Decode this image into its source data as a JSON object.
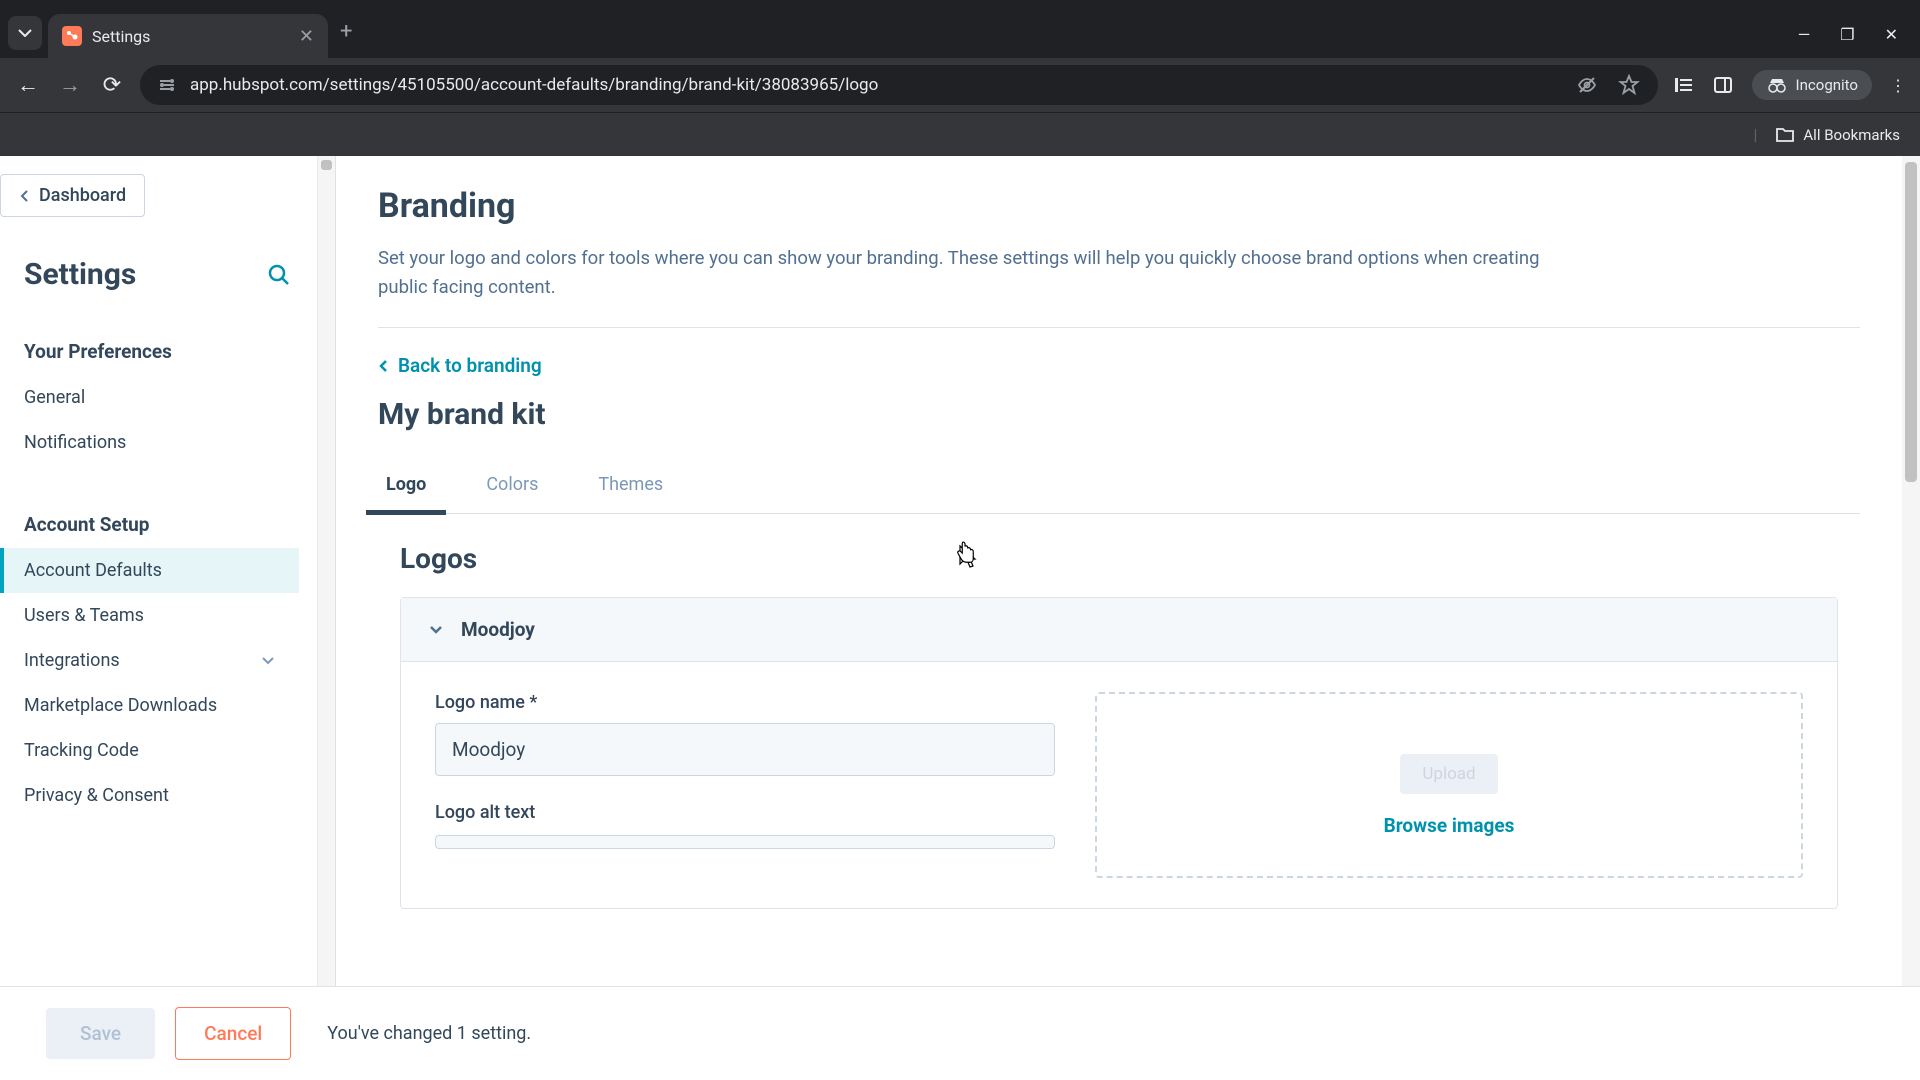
{
  "browser": {
    "tab_title": "Settings",
    "url": "app.hubspot.com/settings/45105500/account-defaults/branding/brand-kit/38083965/logo",
    "incognito_label": "Incognito",
    "bookmarks_label": "All Bookmarks"
  },
  "sidebar": {
    "dashboard_label": "Dashboard",
    "title": "Settings",
    "sections": [
      {
        "header": "Your Preferences",
        "items": [
          "General",
          "Notifications"
        ]
      },
      {
        "header": "Account Setup",
        "items": [
          "Account Defaults",
          "Users & Teams",
          "Integrations",
          "Marketplace Downloads",
          "Tracking Code",
          "Privacy & Consent"
        ]
      }
    ]
  },
  "main": {
    "heading": "Branding",
    "description": "Set your logo and colors for tools where you can show your branding. These settings will help you quickly choose brand options when creating public facing content.",
    "back_link": "Back to branding",
    "subheading": "My brand kit",
    "tabs": [
      "Logo",
      "Colors",
      "Themes"
    ],
    "active_tab": "Logo",
    "section_title": "Logos",
    "accordion_title": "Moodjoy",
    "form": {
      "logo_name_label": "Logo name *",
      "logo_name_value": "Moodjoy",
      "logo_alt_label": "Logo alt text"
    },
    "upload": {
      "button_label": "Upload",
      "browse_label": "Browse images"
    }
  },
  "save_bar": {
    "save_label": "Save",
    "cancel_label": "Cancel",
    "message": "You've changed 1 setting."
  }
}
